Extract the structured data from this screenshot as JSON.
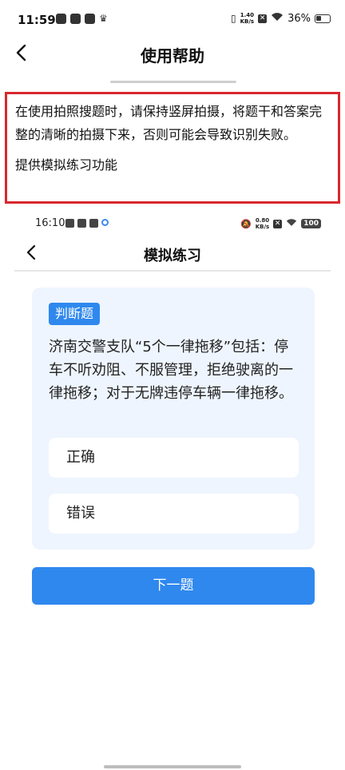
{
  "status_bar": {
    "time": "11:59",
    "net_speed_value": "1.40",
    "net_speed_unit": "KB/s",
    "battery": "36%"
  },
  "header": {
    "title": "使用帮助"
  },
  "help": {
    "text": "在使用拍照搜题时，请保持竖屏拍摄，将题干和答案完整的清晰的拍摄下来，否则可能会导致识别失败。",
    "feature": "提供模拟练习功能"
  },
  "embedded": {
    "status_bar": {
      "time": "16:10",
      "net_speed_value": "0.80",
      "net_speed_unit": "KB/s",
      "battery": "100"
    },
    "header": {
      "title": "模拟练习"
    },
    "question": {
      "type_badge": "判断题",
      "text": "济南交警支队“5个一律拖移”包括：停车不听劝阻、不服管理，拒绝驶离的一律拖移；对于无牌违停车辆一律拖移。",
      "options": [
        "正确",
        "错误"
      ]
    },
    "next_button": "下一题"
  },
  "colors": {
    "accent": "#2f88ee",
    "highlight_border": "#d9272e",
    "card_bg": "#eef5fe"
  }
}
